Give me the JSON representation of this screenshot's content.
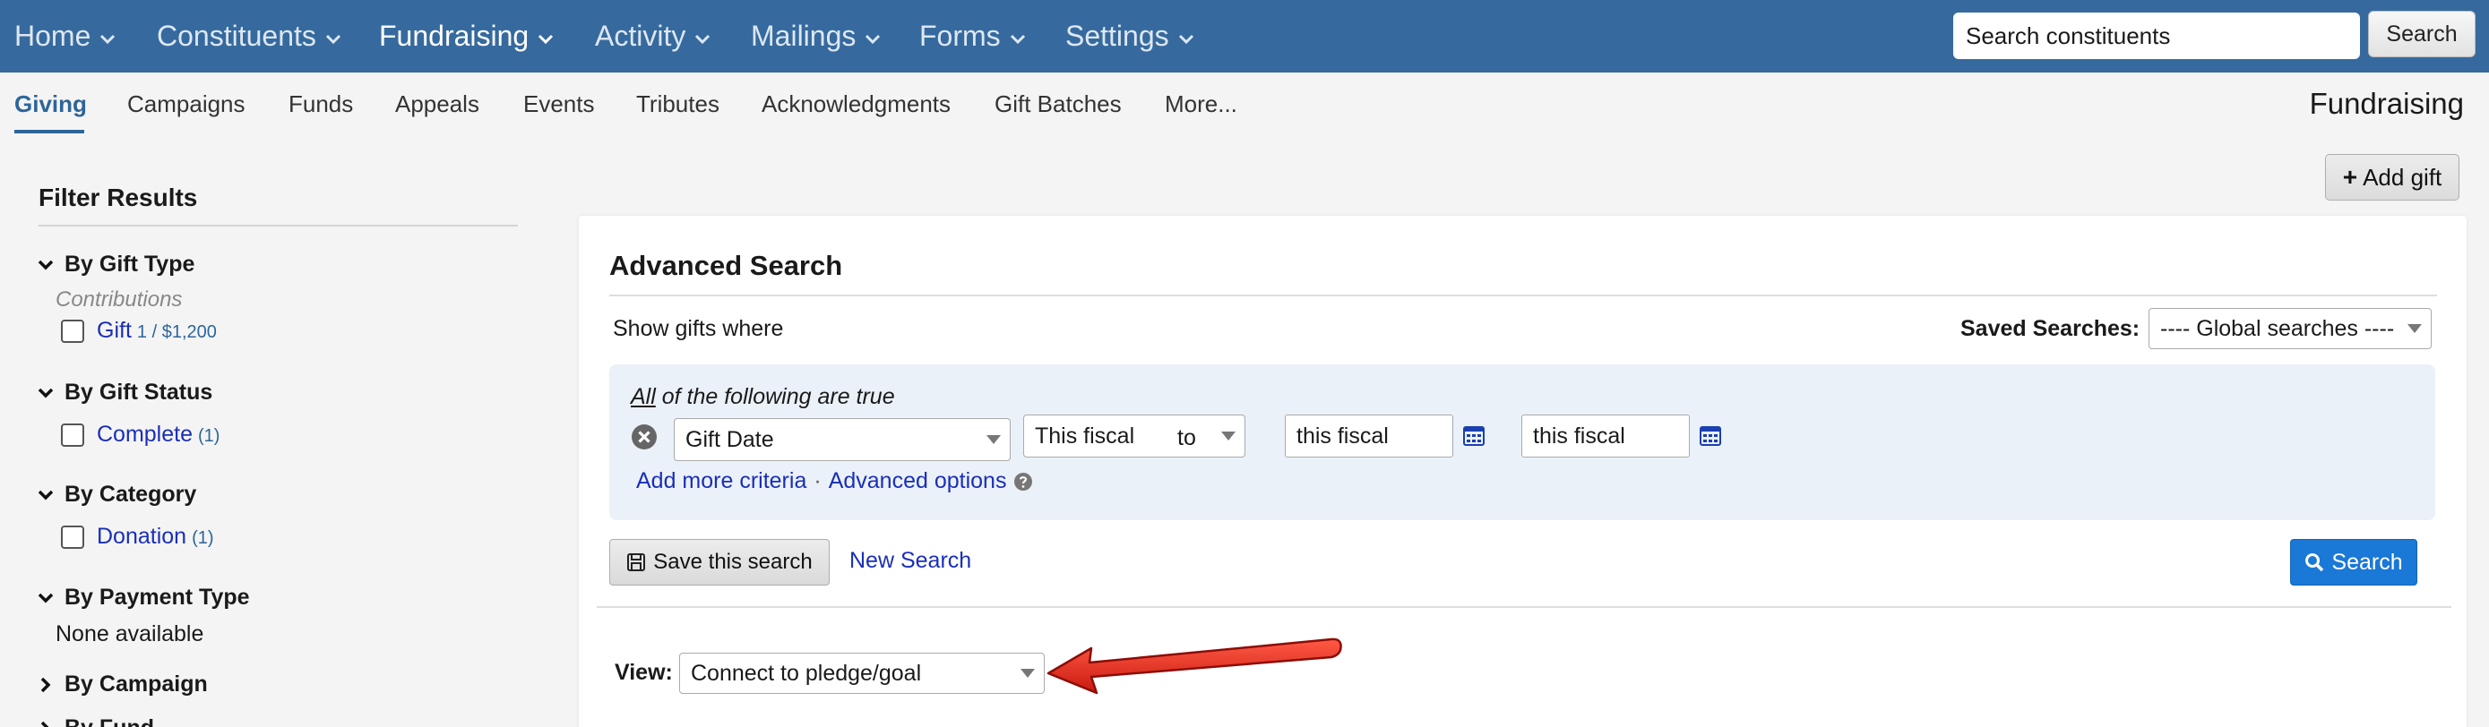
{
  "topnav": {
    "items": [
      {
        "label": "Home"
      },
      {
        "label": "Constituents"
      },
      {
        "label": "Fundraising"
      },
      {
        "label": "Activity"
      },
      {
        "label": "Mailings"
      },
      {
        "label": "Forms"
      },
      {
        "label": "Settings"
      }
    ],
    "active": "Fundraising",
    "search_value": "Search constituents",
    "search_button": "Search",
    "bar_color": "#366a9e"
  },
  "subnav": {
    "items": [
      {
        "label": "Giving"
      },
      {
        "label": "Campaigns"
      },
      {
        "label": "Funds"
      },
      {
        "label": "Appeals"
      },
      {
        "label": "Events"
      },
      {
        "label": "Tributes"
      },
      {
        "label": "Acknowledgments"
      },
      {
        "label": "Gift Batches"
      },
      {
        "label": "More..."
      }
    ],
    "active": "Giving",
    "section_title": "Fundraising"
  },
  "actions": {
    "add_gift": "Add gift"
  },
  "sidebar": {
    "title": "Filter Results",
    "groups": [
      {
        "label": "By Gift Type",
        "caption": "Contributions",
        "option": "Gift",
        "count": "1 / $1,200"
      },
      {
        "label": "By Gift Status",
        "option": "Complete",
        "count": "(1)"
      },
      {
        "label": "By Category",
        "option": "Donation",
        "count": "(1)"
      },
      {
        "label": "By Payment Type",
        "none": "None available"
      },
      {
        "label": "By Campaign"
      },
      {
        "label": "By Fund"
      }
    ]
  },
  "search": {
    "title": "Advanced Search",
    "show_where": "Show gifts where",
    "saved_label": "Saved Searches:",
    "saved_value": "---- Global searches ----",
    "all_word": "All",
    "all_rest": " of the following are true",
    "field": "Gift Date",
    "operator": "This fiscal",
    "from": "this fiscal",
    "to_word": "to",
    "to": "this fiscal",
    "add_more": "Add more criteria",
    "separator": "·",
    "advanced": "Advanced options",
    "save_button": "Save this search",
    "new_search": "New Search",
    "search_button": "Search",
    "view_label": "View:",
    "view_value": "Connect to pledge/goal"
  },
  "colors": {
    "link": "#1a2fb8",
    "primary": "#1a78d6",
    "arrow": "#e0281b"
  }
}
